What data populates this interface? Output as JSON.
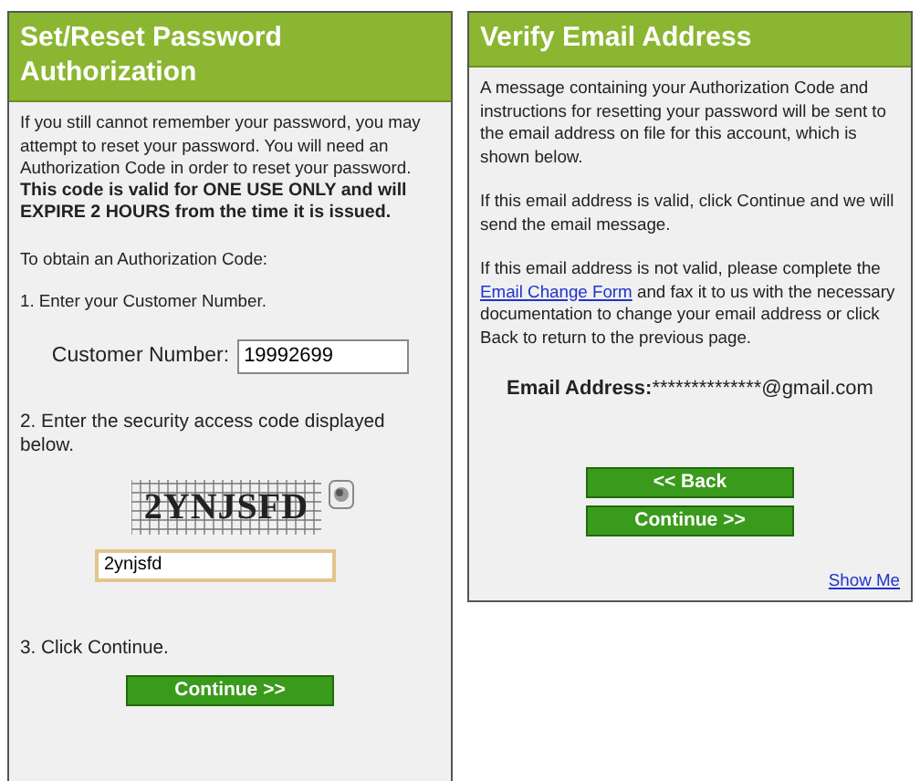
{
  "reset_panel": {
    "title": "Set/Reset Password Authorization",
    "intro": "If you still cannot remember your password, you may attempt to reset your password. You will need an Authorization Code in order to reset your password.",
    "warning": "This code is valid for ONE USE ONLY and will EXPIRE 2 HOURS from the time it is issued.",
    "obtain": "To obtain an Authorization Code:",
    "step_1": "1. Enter your Customer Number.",
    "customer_number": {
      "label": "Customer Number:",
      "value": "19992699"
    },
    "step_2": "2. Enter the security access code displayed below.",
    "captcha": {
      "code": "2YNJSFD"
    },
    "captcha_input": {
      "value": "2ynjsfd"
    },
    "step_3": "3. Click Continue.",
    "button": "Continue >>"
  },
  "verify_panel": {
    "title": "Verify Email Address",
    "paragraphs": [
      {
        "text": "A message containing your Authorization Code and instructions for resetting your password will be sent to the email address on file for this account, which is shown below."
      },
      {
        "text": "If this email address is valid, click Continue and we will send the email message."
      },
      {
        "text": "If this email address is not valid, please complete the",
        "link": "Email Change Form",
        "after": "and fax it to us with the necessary documentation to change your email address or click Back to return to the previous page."
      }
    ],
    "email": {
      "label": "Email Address:",
      "value": "**************@gmail.com"
    },
    "buttons": [
      "<< Back",
      "Continue >>"
    ],
    "show_me": "Show Me"
  }
}
